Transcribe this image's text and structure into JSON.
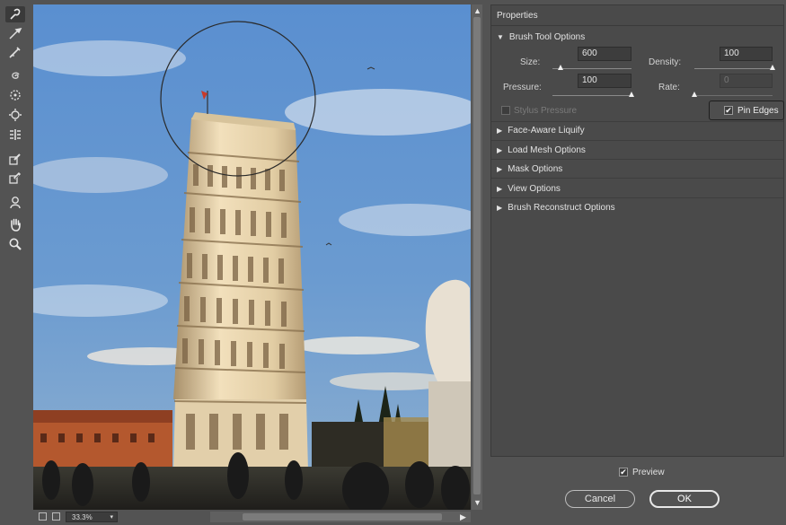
{
  "toolbar": {
    "tools": [
      {
        "name": "forward-warp-tool-icon",
        "active": true
      },
      {
        "name": "reconstruct-tool-icon"
      },
      {
        "name": "smooth-tool-icon"
      },
      {
        "name": "twirl-clockwise-tool-icon"
      },
      {
        "name": "pucker-tool-icon"
      },
      {
        "name": "bloat-tool-icon"
      },
      {
        "name": "push-left-tool-icon"
      },
      {
        "name": "freeze-mask-tool-icon"
      },
      {
        "name": "thaw-mask-tool-icon"
      },
      {
        "name": "face-tool-icon"
      },
      {
        "name": "hand-tool-icon"
      },
      {
        "name": "zoom-tool-icon"
      }
    ]
  },
  "status": {
    "zoom": "33.3%"
  },
  "properties": {
    "title": "Properties",
    "brush": {
      "header": "Brush Tool Options",
      "size_label": "Size:",
      "size_value": "600",
      "size_level": 0.1,
      "density_label": "Density:",
      "density_value": "100",
      "density_level": 1.0,
      "pressure_label": "Pressure:",
      "pressure_value": "100",
      "pressure_level": 1.0,
      "rate_label": "Rate:",
      "rate_value": "0",
      "rate_level": 0.0,
      "stylus_label": "Stylus Pressure",
      "stylus_checked": false,
      "pin_label": "Pin Edges",
      "pin_checked": true
    },
    "sections": [
      "Face-Aware Liquify",
      "Load Mesh Options",
      "Mask Options",
      "View Options",
      "Brush Reconstruct Options"
    ]
  },
  "footer": {
    "preview_label": "Preview",
    "preview_checked": true,
    "cancel_label": "Cancel",
    "ok_label": "OK"
  },
  "colors": {
    "background": "#535353",
    "panel": "#4a4a4a",
    "sky": "#4f86c6",
    "tower": "#e6d3ac"
  }
}
